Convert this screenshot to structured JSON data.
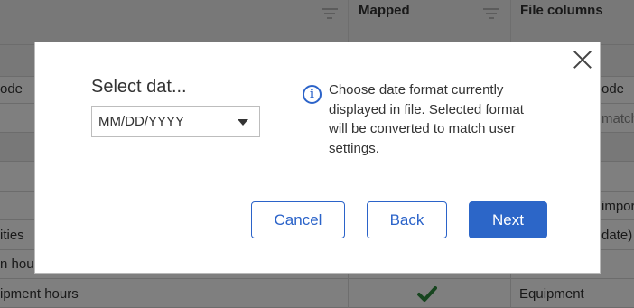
{
  "background_table": {
    "headers": {
      "mapped": "Mapped",
      "file_columns": "File columns"
    },
    "left_fragments": {
      "row_3": "ode",
      "row_7": "ities",
      "row_8": "n hour",
      "row_9": "ipment hours"
    },
    "right_fragments": {
      "row_3": "ode",
      "row_4": "matchi",
      "row_6": "impor",
      "row_7": "date)",
      "row_9": "Equipment"
    },
    "check_icon": "check-icon"
  },
  "dialog": {
    "field_label": "Select dat...",
    "date_format_select": {
      "value": "MM/DD/YYYY"
    },
    "info_text": "Choose date format currently displayed in file. Selected format will be converted to match user settings.",
    "buttons": {
      "cancel": "Cancel",
      "back": "Back",
      "next": "Next"
    }
  },
  "colors": {
    "accent": "#2c66c8",
    "check": "#2e8b3e",
    "overlay": "rgba(0,0,0,0.5)"
  }
}
